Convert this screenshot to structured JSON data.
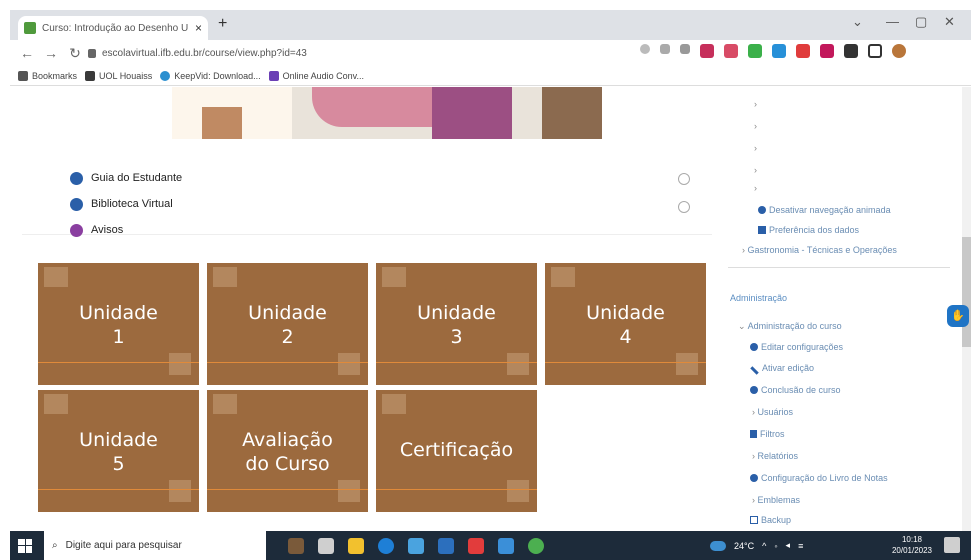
{
  "browser": {
    "tab_title": "Curso: Introdução ao Desenho U",
    "tab_close": "×",
    "new_tab": "+",
    "url": "escolavirtual.ifb.edu.br/course/view.php?id=43",
    "win_min": "—",
    "win_restore": "▢",
    "win_close": "✕",
    "win_down": "⌄"
  },
  "bookmarks": [
    {
      "label": "Bookmarks",
      "color": "#555555"
    },
    {
      "label": "UOL Houaiss",
      "color": "#3a3a3a"
    },
    {
      "label": "KeepVid: Download...",
      "color": "#2b8fd0"
    },
    {
      "label": "Online Audio Conv...",
      "color": "#6a3fb5"
    }
  ],
  "course_links": [
    {
      "label": "Guia do Estudante",
      "icon": "book-icon",
      "color": "#2a5fa8"
    },
    {
      "label": "Biblioteca Virtual",
      "icon": "library-icon",
      "color": "#2a5fa8"
    },
    {
      "label": "Avisos",
      "icon": "forum-icon",
      "color": "#8a3fa0"
    }
  ],
  "tiles": [
    {
      "line1": "Unidade",
      "line2": "1"
    },
    {
      "line1": "Unidade",
      "line2": "2"
    },
    {
      "line1": "Unidade",
      "line2": "3"
    },
    {
      "line1": "Unidade",
      "line2": "4"
    },
    {
      "line1": "Unidade",
      "line2": "5"
    },
    {
      "line1": "Avaliação",
      "line2": "do Curso"
    },
    {
      "line1": "Certificação",
      "line2": ""
    }
  ],
  "sidebar": {
    "chevron": "›",
    "disable_animated_nav": "Desativar navegação animada",
    "data_preference": "Preferência dos dados",
    "gastronomia": "Gastronomia - Técnicas e Operações",
    "admin_header": "Administração",
    "course_admin": "Administração do curso",
    "items": [
      {
        "label": "Editar configurações",
        "icon": "gear-icon"
      },
      {
        "label": "Ativar edição",
        "icon": "pencil-icon"
      },
      {
        "label": "Conclusão de curso",
        "icon": "gear-icon"
      },
      {
        "label": "Usuários",
        "icon": "chevron-right-icon"
      },
      {
        "label": "Filtros",
        "icon": "filter-icon"
      },
      {
        "label": "Relatórios",
        "icon": "chevron-right-icon"
      },
      {
        "label": "Configuração do Livro de Notas",
        "icon": "gear-icon"
      },
      {
        "label": "Emblemas",
        "icon": "chevron-right-icon"
      },
      {
        "label": "Backup",
        "icon": "backup-icon"
      }
    ]
  },
  "taskbar": {
    "search_placeholder": "Digite aqui para pesquisar",
    "temperature": "24°C",
    "time": "10:18",
    "date": "20/01/2023"
  }
}
